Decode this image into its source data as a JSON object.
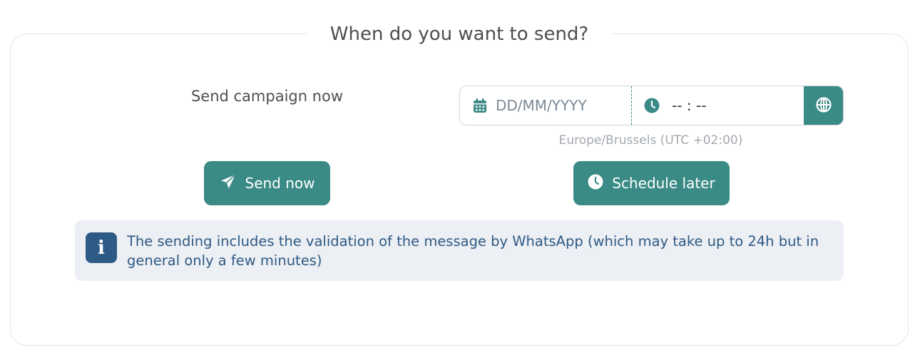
{
  "section": {
    "title": "When do you want to send?"
  },
  "send_now": {
    "label": "Send campaign now",
    "button_label": "Send now",
    "icon": "paper-plane-icon"
  },
  "schedule": {
    "date_placeholder": "DD/MM/YYYY",
    "date_icon": "calendar-icon",
    "time_value": "-- : --",
    "time_icon": "clock-icon",
    "timezone_icon": "globe-icon",
    "timezone_label": "Europe/Brussels (UTC +02:00)",
    "button_label": "Schedule later",
    "button_icon": "clock-icon"
  },
  "info": {
    "icon": "info-icon",
    "text": "The sending includes the validation of the message by WhatsApp (which may take up to 24h but in general only a few minutes)"
  },
  "colors": {
    "accent": "#3a8a86",
    "info_bg": "#eceff4",
    "info_text": "#2f5a84",
    "info_icon_bg": "#2d5b86"
  }
}
